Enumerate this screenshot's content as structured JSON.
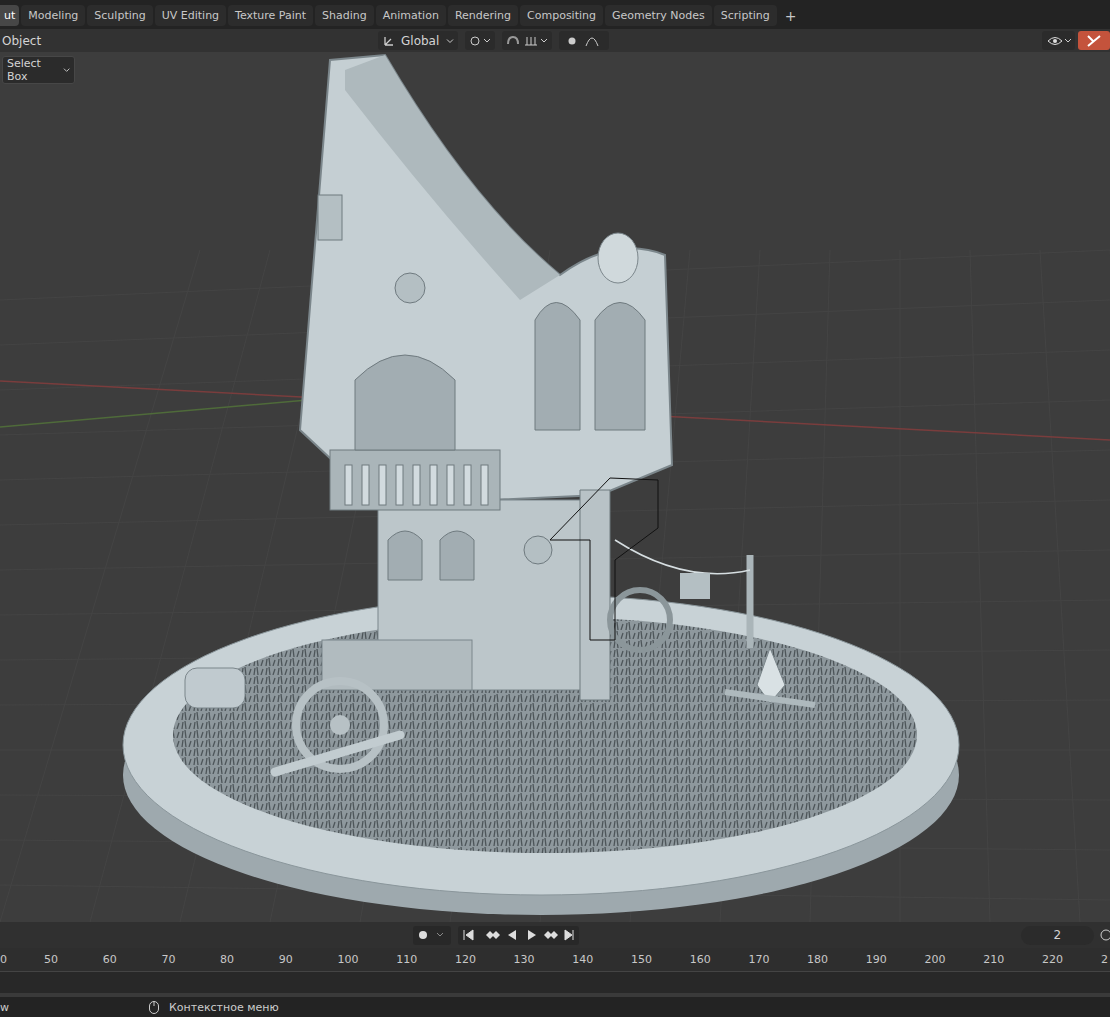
{
  "workspace_tabs": [
    {
      "label": "ut",
      "selected": true
    },
    {
      "label": "Modeling",
      "selected": false
    },
    {
      "label": "Sculpting",
      "selected": false
    },
    {
      "label": "UV Editing",
      "selected": false
    },
    {
      "label": "Texture Paint",
      "selected": false
    },
    {
      "label": "Shading",
      "selected": false
    },
    {
      "label": "Animation",
      "selected": false
    },
    {
      "label": "Rendering",
      "selected": false
    },
    {
      "label": "Compositing",
      "selected": false
    },
    {
      "label": "Geometry Nodes",
      "selected": false
    },
    {
      "label": "Scripting",
      "selected": false
    }
  ],
  "add_tab": "+",
  "header": {
    "mode": "Object",
    "orientation": "Global"
  },
  "tool_button": "Select Box",
  "timeline": {
    "current_frame": "2",
    "ruler": [
      "0",
      "50",
      "60",
      "70",
      "80",
      "90",
      "100",
      "110",
      "120",
      "130",
      "140",
      "150",
      "160",
      "170",
      "180",
      "190",
      "200",
      "210",
      "220",
      "2"
    ]
  },
  "status_bar": {
    "left": "w",
    "mouse_hint": "Контекстное меню"
  }
}
